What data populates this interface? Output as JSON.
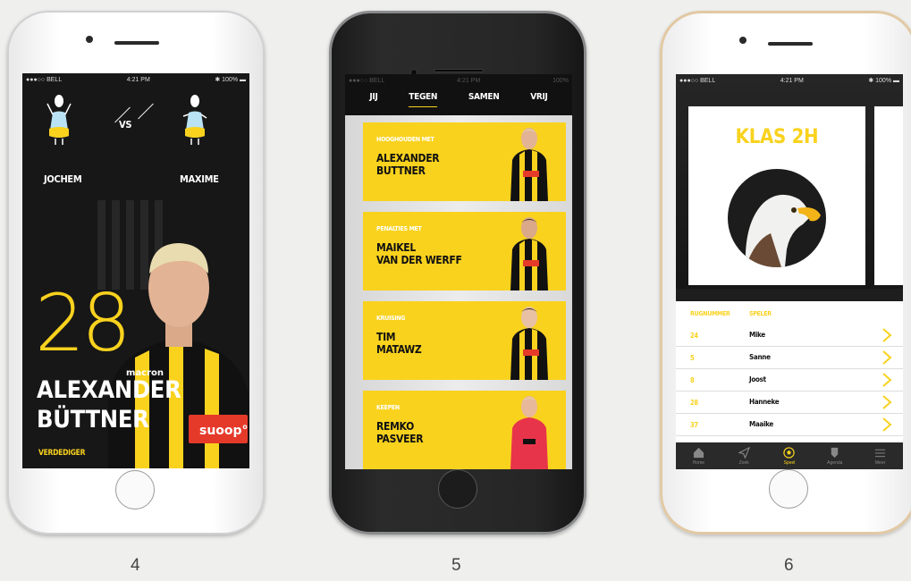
{
  "colors": {
    "accent": "#f9d21e",
    "dark": "#171717"
  },
  "statusbar": {
    "carrier": "●●●○○ BELL",
    "time": "4:21 PM",
    "battery": "100%",
    "bluetooth_icon": "bluetooth-icon",
    "wifi_icon": "wifi-icon"
  },
  "steps": [
    "4",
    "5",
    "6"
  ],
  "screen4": {
    "vs_label": "VS",
    "player_left": "JOCHEM",
    "player_right": "MAXIME",
    "jersey_number": "28",
    "player_name_line1": "ALEXANDER",
    "player_name_line2": "BÜTTNER",
    "position": "VERDEDIGER"
  },
  "screen5": {
    "tabs": [
      {
        "label": "JIJ",
        "active": false
      },
      {
        "label": "TEGEN",
        "active": true
      },
      {
        "label": "SAMEN",
        "active": false
      },
      {
        "label": "VRIJ",
        "active": false
      }
    ],
    "cards": [
      {
        "kicker": "HOOGHOUDEN MET",
        "line1": "ALEXANDER",
        "line2": "BUTTNER"
      },
      {
        "kicker": "PENALTIES MET",
        "line1": "MAIKEL",
        "line2": "VAN DER WERFF"
      },
      {
        "kicker": "KRUISING",
        "line1": "TIM",
        "line2": "MATAWZ"
      },
      {
        "kicker": "KEEPEN",
        "line1": "REMKO",
        "line2": "PASVEER"
      }
    ]
  },
  "screen6": {
    "class_title": "KLAS 2H",
    "table_headers": {
      "number": "RUGNUMMER",
      "player": "SPELER"
    },
    "rows": [
      {
        "number": "24",
        "name": "Mike"
      },
      {
        "number": "5",
        "name": "Sanne"
      },
      {
        "number": "8",
        "name": "Joost"
      },
      {
        "number": "28",
        "name": "Hanneke"
      },
      {
        "number": "37",
        "name": "Maaike"
      }
    ],
    "nav": [
      {
        "label": "Home",
        "icon": "home-icon",
        "active": false
      },
      {
        "label": "Zoek",
        "icon": "send-icon",
        "active": false
      },
      {
        "label": "Speel",
        "icon": "soccer-ball-icon",
        "active": true
      },
      {
        "label": "Agenda",
        "icon": "shield-icon",
        "active": false
      },
      {
        "label": "Meer",
        "icon": "menu-icon",
        "active": false
      }
    ]
  }
}
